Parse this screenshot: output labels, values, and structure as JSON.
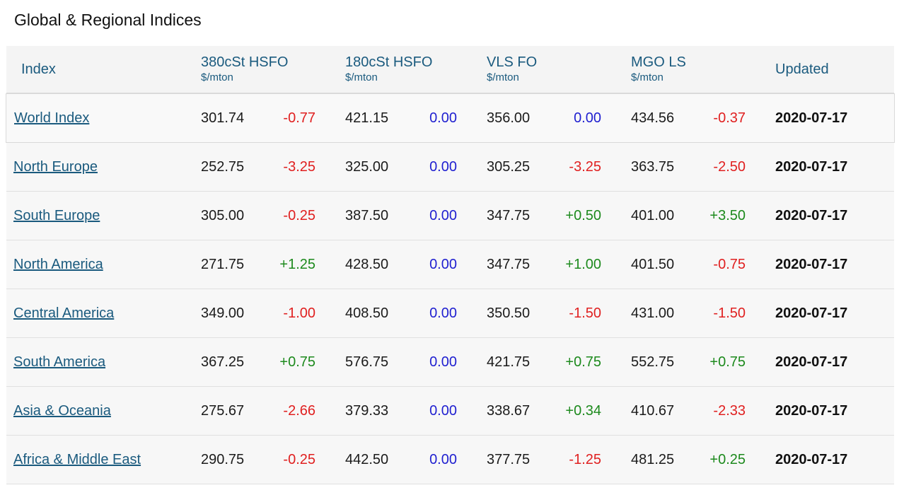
{
  "title": "Global & Regional Indices",
  "header": {
    "index": "Index",
    "cols": [
      {
        "name": "380cSt HSFO",
        "unit": "$/mton"
      },
      {
        "name": "180cSt HSFO",
        "unit": "$/mton"
      },
      {
        "name": "VLS FO",
        "unit": "$/mton"
      },
      {
        "name": "MGO LS",
        "unit": "$/mton"
      }
    ],
    "updated": "Updated"
  },
  "rows": [
    {
      "name": "World Index",
      "v380": "301.74",
      "c380": "-0.77",
      "v180": "421.15",
      "c180": "0.00",
      "vls": "356.00",
      "cvls": "0.00",
      "mgo": "434.56",
      "cmgo": "-0.37",
      "updated": "2020-07-17"
    },
    {
      "name": "North Europe",
      "v380": "252.75",
      "c380": "-3.25",
      "v180": "325.00",
      "c180": "0.00",
      "vls": "305.25",
      "cvls": "-3.25",
      "mgo": "363.75",
      "cmgo": "-2.50",
      "updated": "2020-07-17"
    },
    {
      "name": "South Europe",
      "v380": "305.00",
      "c380": "-0.25",
      "v180": "387.50",
      "c180": "0.00",
      "vls": "347.75",
      "cvls": "+0.50",
      "mgo": "401.00",
      "cmgo": "+3.50",
      "updated": "2020-07-17"
    },
    {
      "name": "North America",
      "v380": "271.75",
      "c380": "+1.25",
      "v180": "428.50",
      "c180": "0.00",
      "vls": "347.75",
      "cvls": "+1.00",
      "mgo": "401.50",
      "cmgo": "-0.75",
      "updated": "2020-07-17"
    },
    {
      "name": "Central America",
      "v380": "349.00",
      "c380": "-1.00",
      "v180": "408.50",
      "c180": "0.00",
      "vls": "350.50",
      "cvls": "-1.50",
      "mgo": "431.00",
      "cmgo": "-1.50",
      "updated": "2020-07-17"
    },
    {
      "name": "South America",
      "v380": "367.25",
      "c380": "+0.75",
      "v180": "576.75",
      "c180": "0.00",
      "vls": "421.75",
      "cvls": "+0.75",
      "mgo": "552.75",
      "cmgo": "+0.75",
      "updated": "2020-07-17"
    },
    {
      "name": "Asia & Oceania",
      "v380": "275.67",
      "c380": "-2.66",
      "v180": "379.33",
      "c180": "0.00",
      "vls": "338.67",
      "cvls": "+0.34",
      "mgo": "410.67",
      "cmgo": "-2.33",
      "updated": "2020-07-17"
    },
    {
      "name": "Africa & Middle East",
      "v380": "290.75",
      "c380": "-0.25",
      "v180": "442.50",
      "c180": "0.00",
      "vls": "377.75",
      "cvls": "-1.25",
      "mgo": "481.25",
      "cmgo": "+0.25",
      "updated": "2020-07-17"
    }
  ],
  "colors": {
    "negative": "#e02020",
    "positive": "#1d8a1d",
    "zero": "#1f1fd0",
    "header_text": "#1a5a7e"
  }
}
